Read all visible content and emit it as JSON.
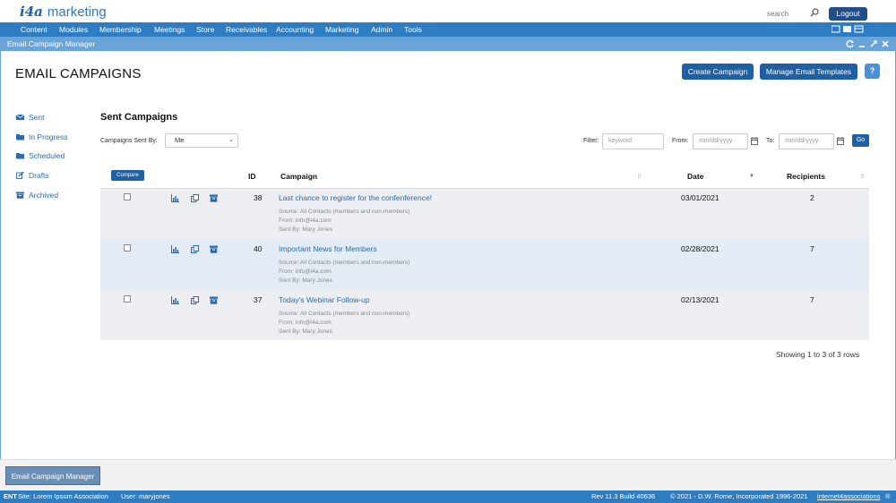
{
  "brand": {
    "logo": "i4a",
    "app_name": "marketing"
  },
  "header": {
    "search_placeholder": "search",
    "logout_label": "Logout"
  },
  "nav": [
    "Content",
    "Modules",
    "Membership",
    "Meetings",
    "Store",
    "Receivables",
    "Accounting",
    "Marketing",
    "Admin",
    "Tools"
  ],
  "window": {
    "title": "Email Campaign Manager"
  },
  "page": {
    "title": "EMAIL CAMPAIGNS",
    "create_campaign_label": "Create Campaign",
    "manage_templates_label": "Manage Email Templates",
    "help_label": "?"
  },
  "sidebar": [
    {
      "label": "Sent",
      "icon": "envelope-icon"
    },
    {
      "label": "In Progress",
      "icon": "folder-icon"
    },
    {
      "label": "Scheduled",
      "icon": "folder-icon"
    },
    {
      "label": "Drafts",
      "icon": "edit-icon"
    },
    {
      "label": "Archived",
      "icon": "archive-icon"
    }
  ],
  "section": {
    "title": "Sent Campaigns",
    "sent_by_label": "Campaigns Sent By:",
    "sent_by_value": "Me",
    "filter_label": "Filter:",
    "filter_placeholder": "keyword",
    "from_label": "From:",
    "from_placeholder": "mm/dd/yyyy",
    "to_label": "To:",
    "to_placeholder": "mm/dd/yyyy",
    "go_label": "Go"
  },
  "table": {
    "compare_label": "Compare",
    "columns": {
      "id": "ID",
      "campaign": "Campaign",
      "date": "Date",
      "recipients": "Recipients"
    },
    "rows": [
      {
        "id": "38",
        "campaign": "Last chance to register for the confenference!",
        "source": "Source: All Contacts (members and non-members)",
        "from": "From: info@i4a.com",
        "sent_by": "Sent By: Mary Jones",
        "date": "03/01/2021",
        "recipients": "2"
      },
      {
        "id": "40",
        "campaign": "Important News for Members",
        "source": "Source: All Contacts (members and non-members)",
        "from": "From: info@i4a.com",
        "sent_by": "Sent By: Mary Jones",
        "date": "02/28/2021",
        "recipients": "7"
      },
      {
        "id": "37",
        "campaign": "Today's Webinar Follow-up",
        "source": "Source: All Contacts (members and non-members)",
        "from": "From: info@i4a.com",
        "sent_by": "Sent By: Mary Jones",
        "date": "02/13/2021",
        "recipients": "7"
      }
    ],
    "showing": "Showing 1 to 3 of 3 rows"
  },
  "taskbar": {
    "button_label": "Email Campaign Manager"
  },
  "status": {
    "env": "ENT",
    "site": "Site: Lorem Ipsum Association",
    "user": "User: maryjones",
    "rev": "Rev 11.3 Build 40636",
    "copyright": "© 2021 - D.W. Rome, Incorporated 1996-2021",
    "link": "internet4associations"
  },
  "colors": {
    "brand_blue": "#2e7dc3",
    "button_blue": "#1f5fa3",
    "window_bar": "#6aa3d8",
    "link": "#2b6cb0"
  }
}
